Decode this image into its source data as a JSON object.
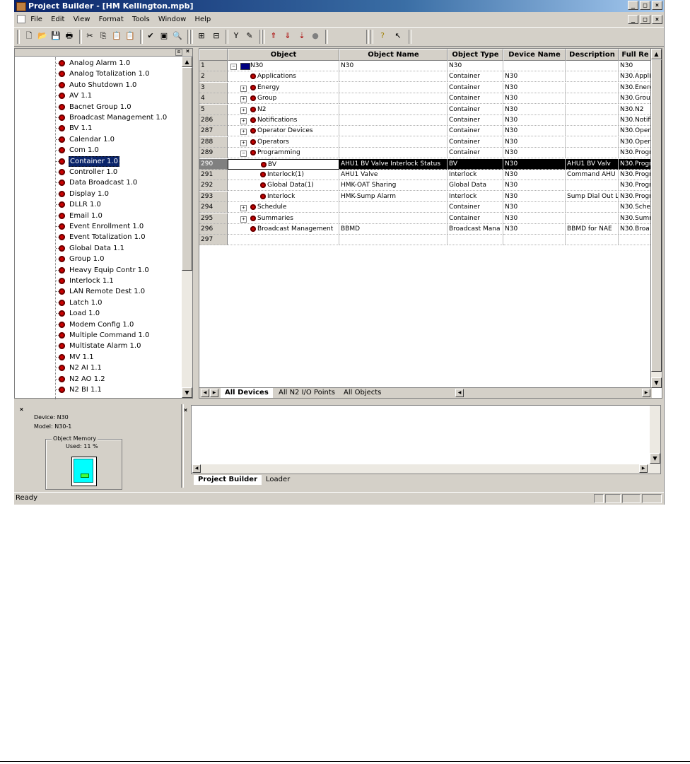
{
  "window": {
    "title": "Project Builder - [HM Kellington.mpb]",
    "controls": [
      "_",
      "□",
      "×"
    ]
  },
  "menu": [
    "File",
    "Edit",
    "View",
    "Format",
    "Tools",
    "Window",
    "Help"
  ],
  "toolbar_icons": [
    "new-icon",
    "open-icon",
    "save-icon",
    "print-icon",
    "cut-icon",
    "copy-icon",
    "paste-icon",
    "paste-special-icon",
    "check-icon",
    "properties-icon",
    "find-icon",
    "add-object-icon",
    "edit-object-icon",
    "filter-icon",
    "edit-icon",
    "upload-icon",
    "download-icon",
    "download-item-icon",
    "stop-icon",
    "help-icon",
    "context-help-icon"
  ],
  "tree": {
    "selected": "Container 1.0",
    "items": [
      "Analog Alarm 1.0",
      "Analog Totalization 1.0",
      "Auto Shutdown 1.0",
      "AV 1.1",
      "Bacnet Group 1.0",
      "Broadcast Management 1.0",
      "BV 1.1",
      "Calendar 1.0",
      "Com 1.0",
      "Container 1.0",
      "Controller 1.0",
      "Data Broadcast 1.0",
      "Display 1.0",
      "DLLR 1.0",
      "Email 1.0",
      "Event Enrollment 1.0",
      "Event Totalization 1.0",
      "Global Data 1.1",
      "Group 1.0",
      "Heavy Equip Contr 1.0",
      "Interlock 1.1",
      "LAN Remote Dest 1.0",
      "Latch 1.0",
      "Load 1.0",
      "Modem Config 1.0",
      "Multiple Command 1.0",
      "Multistate Alarm 1.0",
      "MV 1.1",
      "N2 AI 1.1",
      "N2 AO 1.2",
      "N2 BI 1.1"
    ]
  },
  "grid": {
    "columns": [
      "Object",
      "Object Name",
      "Object Type",
      "Device Name",
      "Description",
      "Full Re"
    ],
    "rows": [
      {
        "num": "1",
        "obj": "N30",
        "indent": 0,
        "exp": "−",
        "icon": "device",
        "name": "N30",
        "type": "N30",
        "dev": "",
        "desc": "",
        "full": "N30"
      },
      {
        "num": "2",
        "obj": "Applications",
        "indent": 1,
        "exp": "",
        "icon": "dot",
        "name": "",
        "type": "Container",
        "dev": "N30",
        "desc": "",
        "full": "N30.Appli"
      },
      {
        "num": "3",
        "obj": "Energy",
        "indent": 1,
        "exp": "+",
        "icon": "dot",
        "name": "",
        "type": "Container",
        "dev": "N30",
        "desc": "",
        "full": "N30.Energ"
      },
      {
        "num": "4",
        "obj": "Group",
        "indent": 1,
        "exp": "+",
        "icon": "dot",
        "name": "",
        "type": "Container",
        "dev": "N30",
        "desc": "",
        "full": "N30.Grou"
      },
      {
        "num": "5",
        "obj": "N2",
        "indent": 1,
        "exp": "+",
        "icon": "dot",
        "name": "",
        "type": "Container",
        "dev": "N30",
        "desc": "",
        "full": "N30.N2"
      },
      {
        "num": "286",
        "obj": "Notifications",
        "indent": 1,
        "exp": "+",
        "icon": "dot",
        "name": "",
        "type": "Container",
        "dev": "N30",
        "desc": "",
        "full": "N30.Notifi"
      },
      {
        "num": "287",
        "obj": "Operator Devices",
        "indent": 1,
        "exp": "+",
        "icon": "dot",
        "name": "",
        "type": "Container",
        "dev": "N30",
        "desc": "",
        "full": "N30.Oper"
      },
      {
        "num": "288",
        "obj": "Operators",
        "indent": 1,
        "exp": "+",
        "icon": "dot",
        "name": "",
        "type": "Container",
        "dev": "N30",
        "desc": "",
        "full": "N30.Oper"
      },
      {
        "num": "289",
        "obj": "Programming",
        "indent": 1,
        "exp": "−",
        "icon": "dot",
        "name": "",
        "type": "Container",
        "dev": "N30",
        "desc": "",
        "full": "N30.Progr"
      },
      {
        "num": "290",
        "obj": "BV",
        "indent": 2,
        "exp": "",
        "icon": "dot",
        "name": "AHU1 BV Valve Interlock Status",
        "type": "BV",
        "dev": "N30",
        "desc": "AHU1 BV Valv",
        "full": "N30.Progr",
        "selected": true
      },
      {
        "num": "291",
        "obj": "Interlock(1)",
        "indent": 2,
        "exp": "",
        "icon": "dot",
        "name": "AHU1 Valve",
        "type": "Interlock",
        "dev": "N30",
        "desc": "Command AHU",
        "full": "N30.Progr"
      },
      {
        "num": "292",
        "obj": "Global Data(1)",
        "indent": 2,
        "exp": "",
        "icon": "dot",
        "name": "HMK-OAT Sharing",
        "type": "Global Data",
        "dev": "N30",
        "desc": "",
        "full": "N30.Progr"
      },
      {
        "num": "293",
        "obj": "Interlock",
        "indent": 2,
        "exp": "",
        "icon": "dot",
        "name": "HMK-Sump Alarm",
        "type": "Interlock",
        "dev": "N30",
        "desc": "Sump Dial Out L",
        "full": "N30.Progr"
      },
      {
        "num": "294",
        "obj": "Schedule",
        "indent": 1,
        "exp": "+",
        "icon": "dot",
        "name": "",
        "type": "Container",
        "dev": "N30",
        "desc": "",
        "full": "N30.Sche"
      },
      {
        "num": "295",
        "obj": "Summaries",
        "indent": 1,
        "exp": "+",
        "icon": "dot",
        "name": "",
        "type": "Container",
        "dev": "N30",
        "desc": "",
        "full": "N30.Summ"
      },
      {
        "num": "296",
        "obj": "Broadcast Management",
        "indent": 1,
        "exp": "",
        "icon": "dot",
        "name": "BBMD",
        "type": "Broadcast Mana",
        "dev": "N30",
        "desc": "BBMD for NAE",
        "full": "N30.Broa"
      },
      {
        "num": "297",
        "obj": "",
        "indent": 0,
        "exp": "",
        "icon": "",
        "name": "",
        "type": "",
        "dev": "",
        "desc": "",
        "full": ""
      }
    ]
  },
  "grid_tabs": [
    "All Devices",
    "All N2 I/O Points",
    "All Objects"
  ],
  "device_panel": {
    "device": "Device: N30",
    "model": "Model: N30-1",
    "memory_label": "Object Memory",
    "used": "Used: 11 %"
  },
  "output_tabs": [
    "Project Builder",
    "Loader"
  ],
  "status": "Ready"
}
